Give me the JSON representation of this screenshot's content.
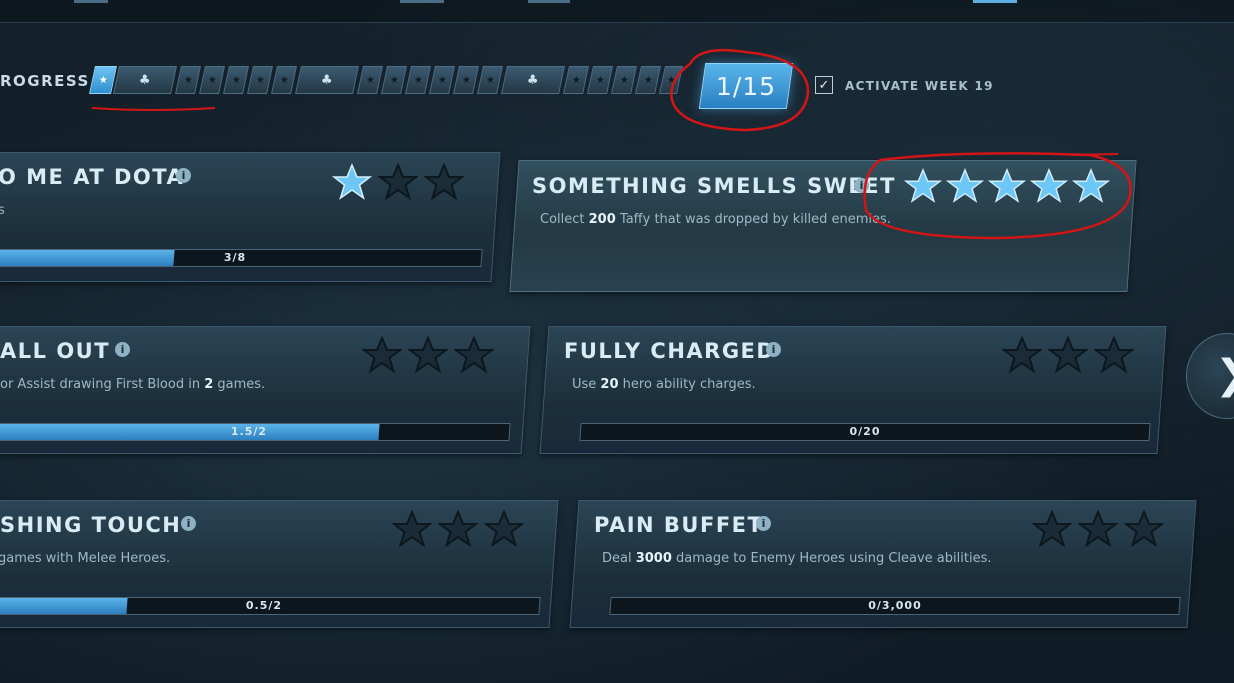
{
  "progress": {
    "label": "ROGRESS",
    "level": "1/15",
    "activate_label": "ACTIVATE WEEK 19",
    "activate_checked": true
  },
  "cards": [
    {
      "id": "dota",
      "title": "O ME AT DOTA",
      "desc_pre": "s",
      "desc_bold": "",
      "desc_post": "",
      "progress": "3/8",
      "fill": 0.375,
      "stars_filled": 1,
      "stars_total": 3
    },
    {
      "id": "sweet",
      "title": "SOMETHING SMELLS SWEET",
      "desc_pre": "Collect ",
      "desc_bold": "200",
      "desc_post": " Taffy that was dropped by killed enemies.",
      "progress": "",
      "fill": 0,
      "stars_filled": 5,
      "stars_total": 5
    },
    {
      "id": "allout",
      "title": "ALL OUT",
      "desc_pre": "or Assist drawing First Blood in ",
      "desc_bold": "2",
      "desc_post": " games.",
      "progress": "1.5/2",
      "fill": 0.75,
      "stars_filled": 0,
      "stars_total": 3
    },
    {
      "id": "charged",
      "title": "FULLY CHARGED",
      "desc_pre": "Use ",
      "desc_bold": "20",
      "desc_post": " hero ability charges.",
      "progress": "0/20",
      "fill": 0,
      "stars_filled": 0,
      "stars_total": 3
    },
    {
      "id": "touch",
      "title": "SHING TOUCH",
      "desc_pre": " games with Melee Heroes.",
      "desc_bold": "",
      "desc_post": "",
      "progress": "0.5/2",
      "fill": 0.25,
      "stars_filled": 0,
      "stars_total": 3
    },
    {
      "id": "buffet",
      "title": "PAIN BUFFET",
      "desc_pre": "Deal ",
      "desc_bold": "3000",
      "desc_post": " damage to Enemy Heroes using Cleave abilities.",
      "progress": "0/3,000",
      "fill": 0,
      "stars_filled": 0,
      "stars_total": 3
    }
  ],
  "footer_text": "",
  "icons": {
    "info": "info-icon",
    "star": "star-icon",
    "next": "chevron-right-icon",
    "reward": "reward-icon"
  },
  "colors": {
    "accent": "#5bb4ea",
    "annotation": "#d41515"
  }
}
